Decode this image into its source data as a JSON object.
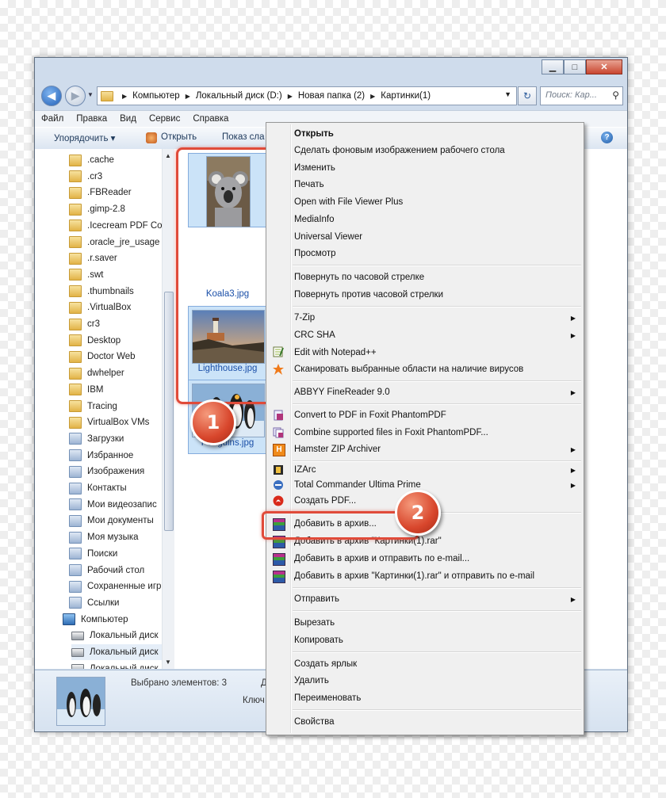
{
  "address": {
    "crumbs": [
      "Компьютер",
      "Локальный диск (D:)",
      "Новая папка (2)",
      "Картинки(1)"
    ],
    "search_placeholder": "Поиск: Кар..."
  },
  "menubar": [
    "Файл",
    "Правка",
    "Вид",
    "Сервис",
    "Справка"
  ],
  "toolbar": {
    "organize": "Упорядочить ▾",
    "open": "Открыть",
    "slideshow": "Показ сла"
  },
  "caption": {
    "minimize": "▁",
    "maximize": "□",
    "close": "✕"
  },
  "nav_items": [
    ".cache",
    ".cr3",
    ".FBReader",
    ".gimp-2.8",
    ".Icecream PDF Co",
    ".oracle_jre_usage",
    ".r.saver",
    ".swt",
    ".thumbnails",
    ".VirtualBox",
    "cr3",
    "Desktop",
    "Doctor Web",
    "dwhelper",
    "IBM",
    "Tracing",
    "VirtualBox VMs",
    "Загрузки",
    "Избранное",
    "Изображения",
    "Контакты",
    "Мои видеозапис",
    "Мои документы",
    "Моя музыка",
    "Поиски",
    "Рабочий стол",
    "Сохраненные игр",
    "Ссылки"
  ],
  "nav_computer": "Компьютер",
  "nav_drives": [
    "Локальный диск",
    "Локальный диск",
    "Локальный диск"
  ],
  "files": [
    "Koala3.jpg",
    "Lighthouse.jpg",
    "Penguins.jpg"
  ],
  "status": {
    "selected": "Выбрано элементов: 3",
    "partial1": "Д",
    "partial2": "Ключ"
  },
  "context_menu": {
    "open": "Открыть",
    "set_wallpaper": "Сделать фоновым изображением рабочего стола",
    "edit": "Изменить",
    "print": "Печать",
    "file_viewer": "Open with File Viewer Plus",
    "mediainfo": "MediaInfo",
    "universal_viewer": "Universal Viewer",
    "preview": "Просмотр",
    "rotate_cw": "Повернуть по часовой стрелке",
    "rotate_ccw": "Повернуть против часовой стрелки",
    "zip7": "7-Zip",
    "crc": "CRC SHA",
    "notepad": "Edit with Notepad++",
    "scan": "Сканировать выбранные области на наличие вирусов",
    "abbyy": "ABBYY FineReader 9.0",
    "foxit_convert": "Convert to PDF in Foxit PhantomPDF",
    "foxit_combine": "Combine supported files in Foxit PhantomPDF...",
    "hamster": "Hamster ZIP Archiver",
    "izarc": "IZArc",
    "total_commander": "Total Commander Ultima Prime",
    "create_pdf": "Создать PDF...",
    "add_archive": "Добавить в архив...",
    "add_rar": "Добавить в архив \"Картинки(1).rar\"",
    "add_email": "Добавить в архив и отправить по e-mail...",
    "add_rar_email": "Добавить в архив \"Картинки(1).rar\" и отправить по e-mail",
    "send_to": "Отправить",
    "cut": "Вырезать",
    "copy": "Копировать",
    "shortcut": "Создать ярлык",
    "delete": "Удалить",
    "rename": "Переименовать",
    "properties": "Свойства"
  },
  "callouts": [
    "1",
    "2"
  ],
  "colors": {
    "callout": "#e04b3a",
    "selection": "#cbe3f8",
    "link": "#1a4fa8"
  }
}
